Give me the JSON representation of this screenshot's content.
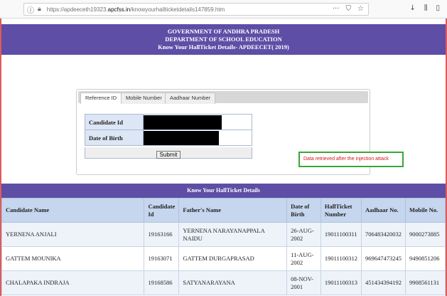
{
  "browser": {
    "url_prefix": "https://apdeeceth19323.",
    "url_domain": "apcfss.in",
    "url_path": "/knowyourhallticketdetails147859.htm",
    "info_icon": "info-icon",
    "lock_icon": "lock-icon",
    "more_icon": "ellipsis-icon",
    "bookmark_icon": "star-icon",
    "download_icon": "download-icon",
    "library_icon": "library-icon",
    "sidebar_icon": "sidebar-icon"
  },
  "header": {
    "line1": "GOVERNMENT OF ANDHRA PRADESH",
    "line2": "DEPARTMENT OF SCHOOL EDUCATION",
    "line3": "Know Your HallTicket Details- APDEECET( 2019)"
  },
  "search": {
    "tabs": [
      {
        "label": "Reference ID",
        "active": true
      },
      {
        "label": "Mobile Number",
        "active": false
      },
      {
        "label": "Aadhaar Number",
        "active": false
      }
    ],
    "candidate_id_label": "Candidate Id",
    "dob_label": "Date of Birth",
    "submit_label": "Submit"
  },
  "annotation": {
    "text": "Data retrieved   after the injection attack",
    "color": "#d4161c",
    "border_color": "#3aa63a"
  },
  "results": {
    "title": "Know Your HallTicket Details",
    "columns": [
      "Candidate Name",
      "Candidate Id",
      "Father's Name",
      "Date of Birth",
      "HallTicket Number",
      "Aadhaar No.",
      "Mobile No."
    ],
    "rows": [
      [
        "YERNENA ANJALI",
        "19163166",
        "YERNENA NARAYANAPPALA NAIDU",
        "26-AUG-2002",
        "19011100311",
        "706483420032",
        "9000273885"
      ],
      [
        "GATTEM MOUNIKA",
        "19163071",
        "GATTEM DURGAPRASAD",
        "11-AUG-2002",
        "19011100312",
        "969647473245",
        "9490851206"
      ],
      [
        "CHALAPAKA INDRAJA",
        "19168586",
        "SATYANARAYANA",
        "08-NOV-2001",
        "19011100313",
        "451434394192",
        "9908561131"
      ]
    ]
  },
  "colors": {
    "banner": "#5e4ea6",
    "table_header": "#c5d6ee",
    "frame_border": "#e05a5a"
  }
}
